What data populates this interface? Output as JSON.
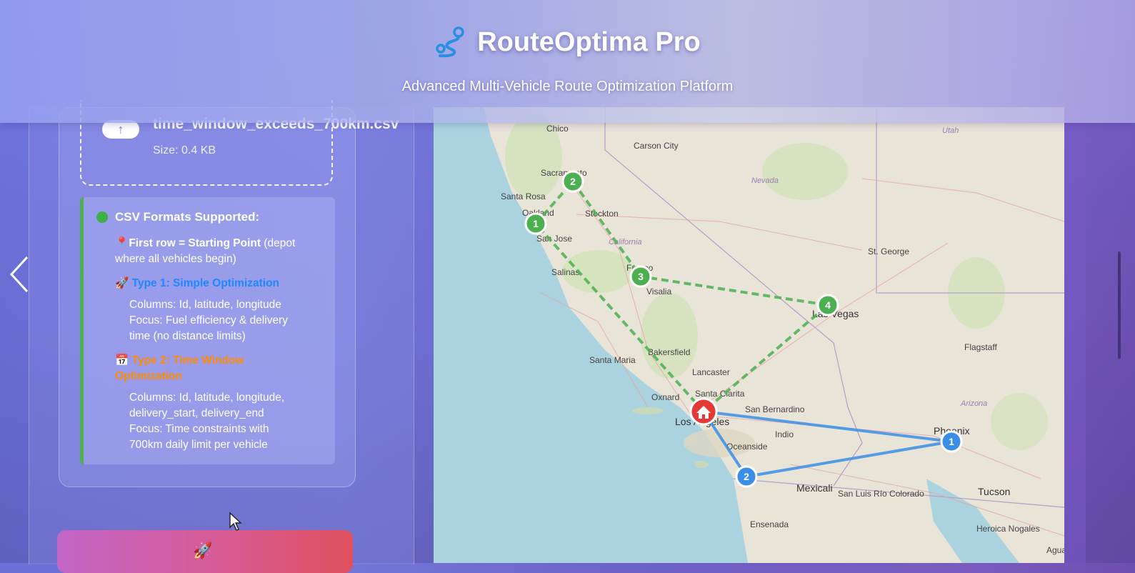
{
  "header": {
    "title": "RouteOptima Pro",
    "subtitle": "Advanced Multi-Vehicle Route Optimization Platform"
  },
  "upload": {
    "file_name": "time_window_exceeds_700km.csv",
    "file_size": "Size: 0.4 KB"
  },
  "formats": {
    "heading": "CSV Formats Supported:",
    "first_row_bold": "First row = Starting Point",
    "first_row_rest": " (depot",
    "first_row_line2": "where all vehicles begin)",
    "type1_title": "Type 1: Simple Optimization",
    "type1_columns": "Columns: Id, latitude, longitude",
    "type1_focus_1": "Focus: Fuel efficiency & delivery",
    "type1_focus_2": "time (no distance limits)",
    "type2_title_1": "Type 2: Time Window",
    "type2_title_2": "Optimization",
    "type2_columns_1": "Columns: Id, latitude, longitude,",
    "type2_columns_2": "delivery_start, delivery_end",
    "type2_focus_1": "Focus: Time constraints with",
    "type2_focus_2": "700km daily limit per vehicle"
  },
  "map": {
    "places": [
      "Chico",
      "Carson City",
      "Sacramento",
      "Santa Rosa",
      "Oakland",
      "Stockton",
      "San Jose",
      "California",
      "Nevada",
      "Fresno",
      "Visalia",
      "Salinas",
      "Las Vegas",
      "St. George",
      "Utah",
      "Bakersfield",
      "Santa Maria",
      "Lancaster",
      "Santa Clarita",
      "Oxnard",
      "San Bernardino",
      "Los Angeles",
      "Indio",
      "Oceanside",
      "Arizona",
      "Flagstaff",
      "Phoenix",
      "Mexicali",
      "San Luis Río Colorado",
      "Tucson",
      "Ensenada",
      "Heroica Nogales",
      "Agua Prieta"
    ],
    "depot_icon": "home-icon",
    "colors": {
      "green_route": "#4caf50",
      "blue_route": "#3a8ee6",
      "depot": "#e53935"
    },
    "green_stops": [
      "1",
      "2",
      "3",
      "4"
    ],
    "blue_stops": [
      "1",
      "2"
    ]
  }
}
